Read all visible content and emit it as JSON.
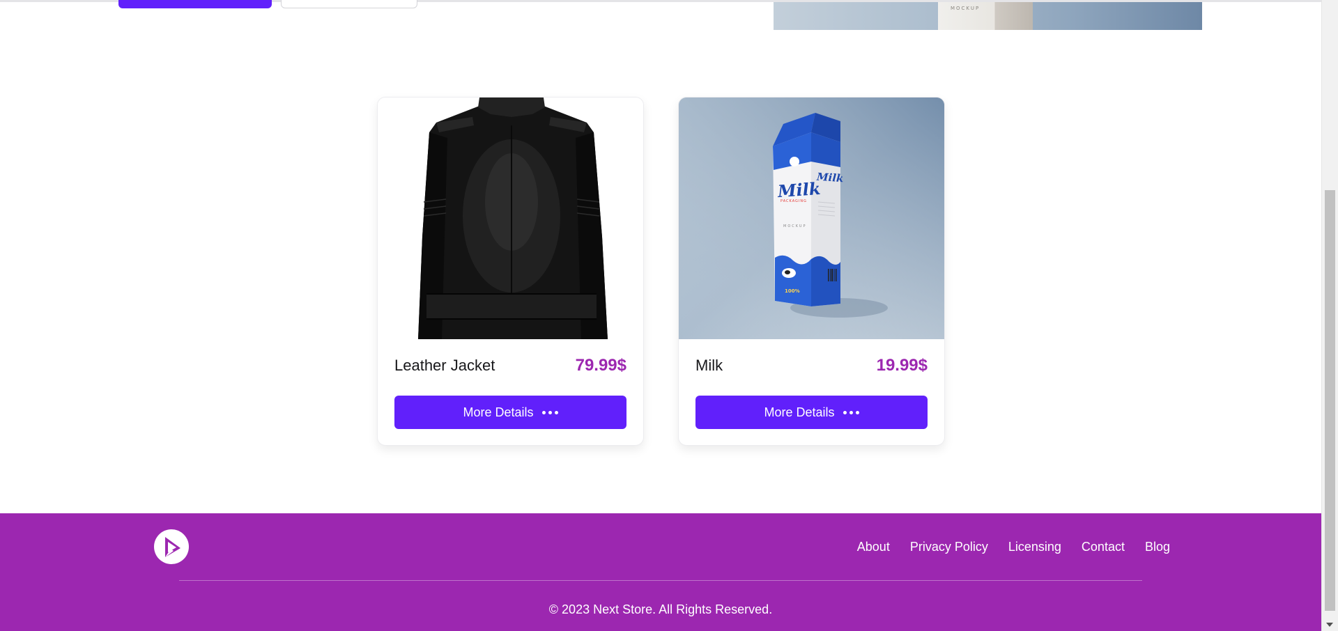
{
  "hero": {
    "carton_text": "MOCKUP"
  },
  "products": [
    {
      "name": "Leather Jacket",
      "price": "79.99$",
      "button_label": "More Details",
      "image": "leather-jacket-image"
    },
    {
      "name": "Milk",
      "price": "19.99$",
      "button_label": "More Details",
      "image": "milk-carton-image",
      "carton_brand": "Milk",
      "carton_sub": "PACKAGING",
      "carton_mid": "MOCKUP",
      "carton_badge": "100%"
    }
  ],
  "footer": {
    "logo": "store-logo-icon",
    "links": [
      "About",
      "Privacy Policy",
      "Licensing",
      "Contact",
      "Blog"
    ],
    "copyright": "© 2023 Next Store. All Rights Reserved."
  },
  "colors": {
    "primary": "#6120fb",
    "accent": "#9c27b0",
    "footer_bg": "#9c27b0"
  }
}
